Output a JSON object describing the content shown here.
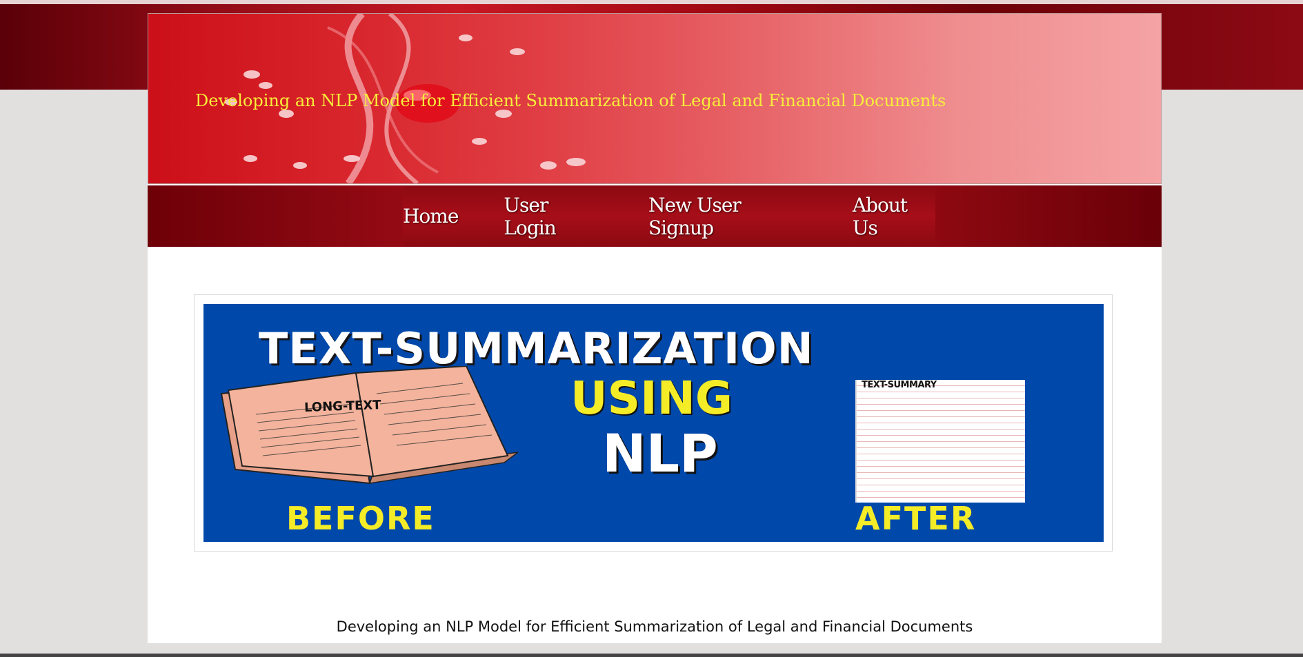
{
  "header": {
    "site_title": "Developing an NLP Model for Efficient Summarization of Legal and Financial Documents"
  },
  "nav": {
    "items": [
      {
        "label": "Home"
      },
      {
        "label": "User Login"
      },
      {
        "label": "New User Signup"
      },
      {
        "label": "About Us"
      }
    ]
  },
  "hero": {
    "headline": "TEXT-SUMMARIZATION",
    "using": "USING",
    "nlp": "NLP",
    "book_label": "LONG-TEXT",
    "paper_label": "TEXT-SUMMARY",
    "before": "BEFORE",
    "after": "AFTER"
  },
  "footer": {
    "caption": "Developing an NLP Model for Efficient Summarization of Legal and Financial Documents"
  },
  "colors": {
    "title_yellow": "#f7ee3a",
    "nav_red": "#a60e18",
    "hero_blue": "#0048aa"
  }
}
